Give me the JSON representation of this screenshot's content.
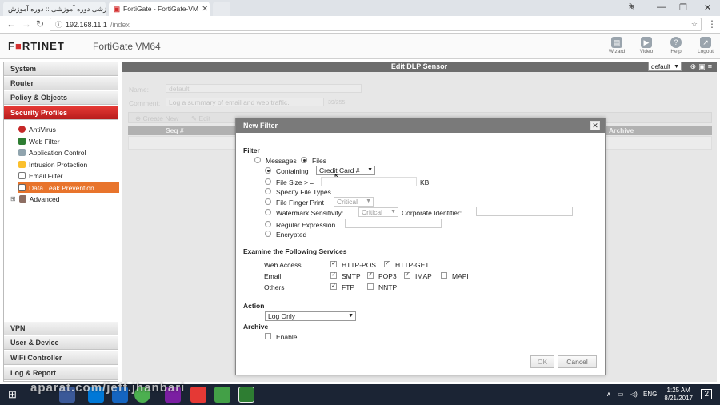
{
  "browser": {
    "tabs": [
      {
        "label": "فیلم آموزشی دوره آموزشی :: دوره آموزش"
      },
      {
        "label": "FortiGate - FortiGate-VM"
      }
    ],
    "window_user": "ऋॆ",
    "address": {
      "host": "192.168.11.1",
      "path": "/index"
    }
  },
  "header": {
    "logo_prefix": "F",
    "logo_mid": "■",
    "logo_rest": "RTINET",
    "model": "FortiGate VM64",
    "icons": [
      {
        "label": "Wizard",
        "icon": "wizard-icon"
      },
      {
        "label": "Video",
        "icon": "video-icon"
      },
      {
        "label": "Help",
        "icon": "help-icon"
      },
      {
        "label": "Logout",
        "icon": "logout-icon"
      }
    ]
  },
  "sidebar": {
    "sections_top": [
      "System",
      "Router",
      "Policy & Objects",
      "Security Profiles"
    ],
    "sub_items": [
      "AntiVirus",
      "Web Filter",
      "Application Control",
      "Intrusion Protection",
      "Email Filter",
      "Data Leak Prevention",
      "Advanced"
    ],
    "sections_bottom": [
      "VPN",
      "User & Device",
      "WiFi Controller",
      "Log & Report"
    ]
  },
  "page": {
    "title": "Edit DLP Sensor",
    "vdom": "default",
    "name_label": "Name:",
    "name_value": "default",
    "comment_label": "Comment:",
    "comment_value": "Log a summary of email and web traffic.",
    "comment_count": "39/255",
    "create_new": "Create New",
    "edit": "Edit",
    "seq_col": "Seq #",
    "archive_col": "Archive"
  },
  "dialog": {
    "title": "New Filter",
    "filter_label": "Filter",
    "messages": "Messages",
    "files": "Files",
    "containing": "Containing",
    "containing_value": "Credit Card #",
    "file_size": "File Size > =",
    "kb": "KB",
    "specify_types": "Specify File Types",
    "finger_print": "File Finger Print",
    "finger_value": "Critical",
    "watermark": "Watermark Sensitivity:",
    "watermark_value": "Critical",
    "corp_id": "Corporate Identifier:",
    "regex": "Regular Expression",
    "encrypted": "Encrypted",
    "examine_label": "Examine the Following Services",
    "web_access": "Web Access",
    "http_post": "HTTP-POST",
    "http_get": "HTTP-GET",
    "email": "Email",
    "smtp": "SMTP",
    "pop3": "POP3",
    "imap": "IMAP",
    "mapi": "MAPI",
    "others": "Others",
    "ftp": "FTP",
    "nntp": "NNTP",
    "action_label": "Action",
    "action_value": "Log Only",
    "archive_label": "Archive",
    "enable": "Enable",
    "ok": "OK",
    "cancel": "Cancel"
  },
  "taskbar": {
    "lang": "ENG",
    "time": "1:25 AM",
    "date": "8/21/2017",
    "notif": "2"
  },
  "watermark": "aparat.com/jeff.jhanbari"
}
